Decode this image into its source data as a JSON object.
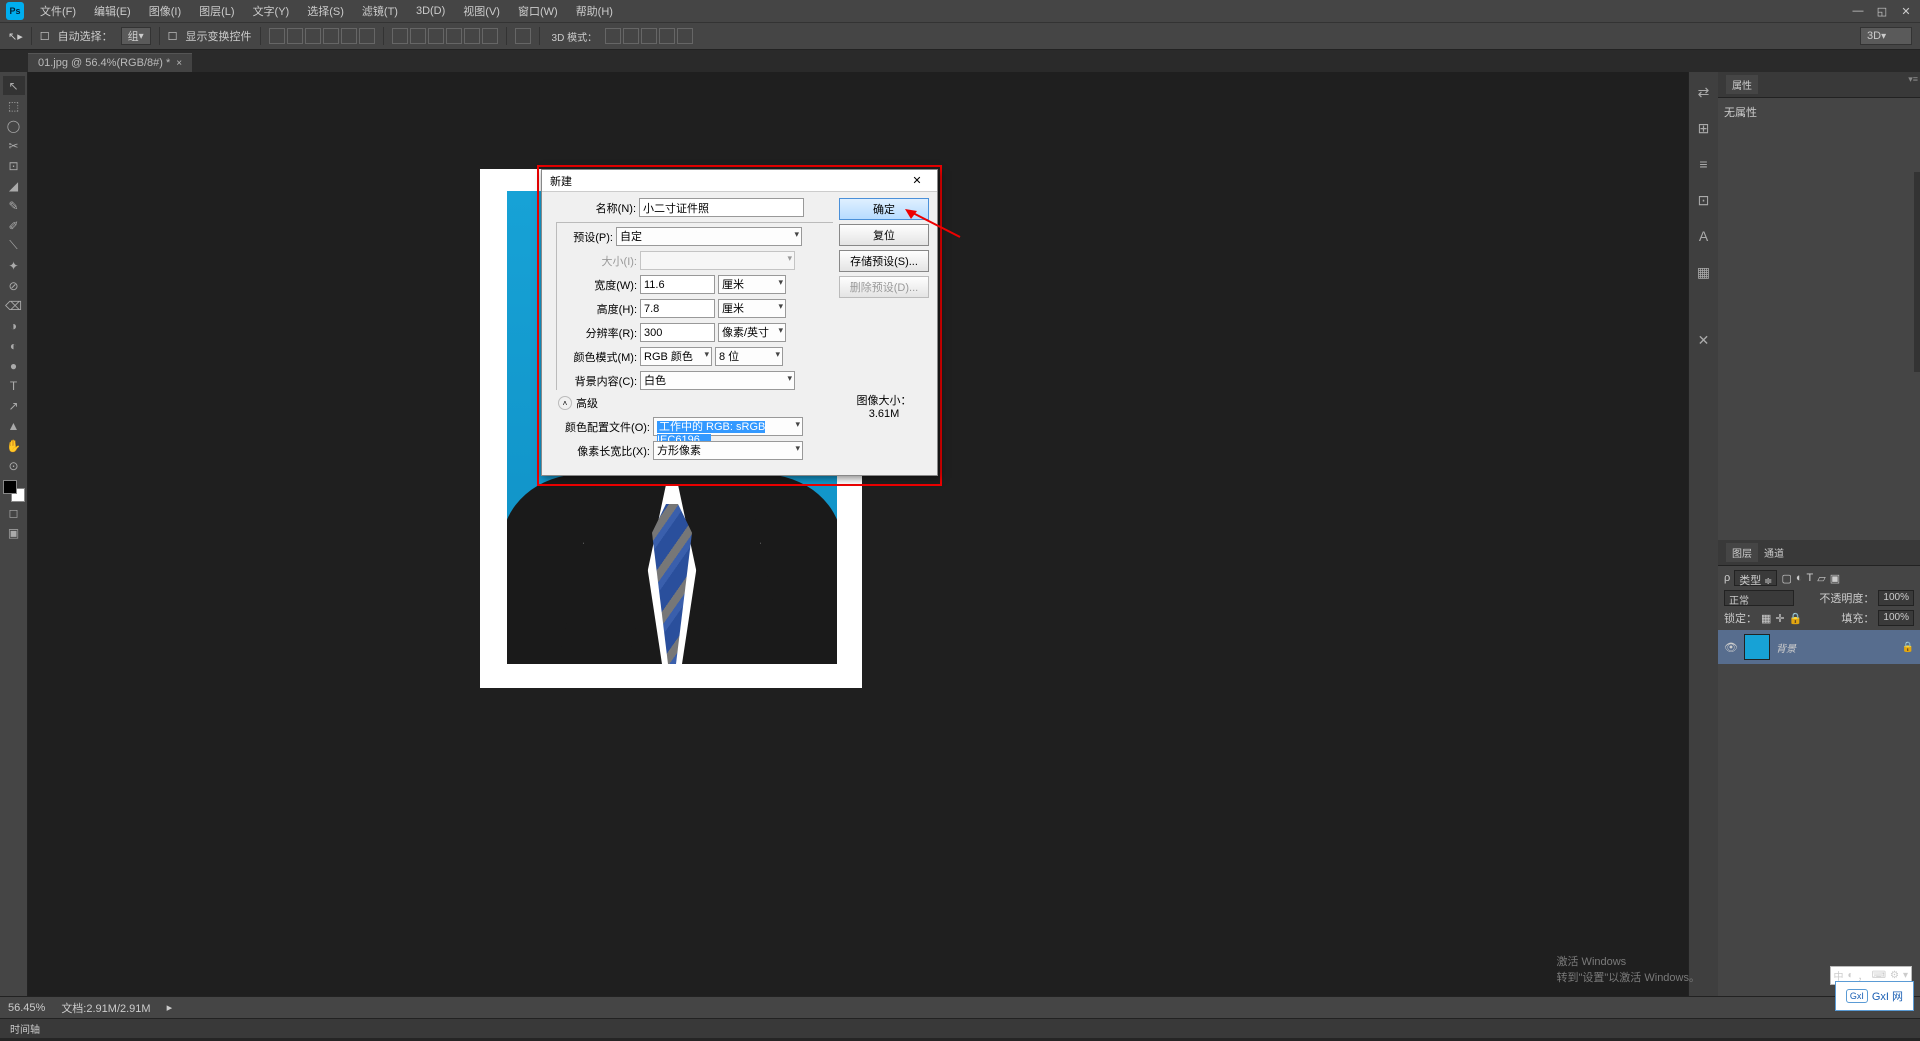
{
  "menubar": {
    "items": [
      "文件(F)",
      "编辑(E)",
      "图像(I)",
      "图层(L)",
      "文字(Y)",
      "选择(S)",
      "滤镜(T)",
      "3D(D)",
      "视图(V)",
      "窗口(W)",
      "帮助(H)"
    ]
  },
  "options_bar": {
    "auto_select_label": "自动选择：",
    "auto_select_target": "组",
    "show_transform_label": "显示变换控件",
    "mode3d_label": "3D 模式：",
    "right_3d": "3D"
  },
  "doc_tab": {
    "title": "01.jpg @ 56.4%(RGB/8#) *"
  },
  "tools": [
    "↖",
    "⬚",
    "◯",
    "✂",
    "⊡",
    "◢",
    "✎",
    "✐",
    "⟍",
    "✦",
    "⊘",
    "⌫",
    "◑",
    "◐",
    "●",
    "▲",
    "✎",
    "T",
    "↗",
    "✥",
    "⊕",
    "✋",
    "⊙"
  ],
  "panel_strip_icons": [
    "⇄",
    "⊞",
    "≡",
    "⊡",
    "A",
    "▦",
    "≡",
    "✕"
  ],
  "properties_panel": {
    "tab": "属性",
    "none_text": "无属性"
  },
  "layers_panel": {
    "tabs": [
      "图层",
      "通道"
    ],
    "type_label": "类型",
    "mode": "正常",
    "opacity_label": "不透明度：",
    "opacity_value": "100%",
    "lock_label": "锁定：",
    "fill_label": "填充：",
    "fill_value": "100%",
    "layer0": {
      "name": "背景"
    }
  },
  "statusbar": {
    "zoom": "56.45%",
    "doc_info": "文档:2.91M/2.91M",
    "timeline_label": "时间轴"
  },
  "dialog": {
    "title": "新建",
    "name_label": "名称(N):",
    "name_value": "小二寸证件照",
    "preset_label": "预设(P):",
    "preset_value": "自定",
    "size_label": "大小(I):",
    "width_label": "宽度(W):",
    "width_value": "11.6",
    "width_unit": "厘米",
    "height_label": "高度(H):",
    "height_value": "7.8",
    "height_unit": "厘米",
    "res_label": "分辨率(R):",
    "res_value": "300",
    "res_unit": "像素/英寸",
    "colormode_label": "颜色模式(M):",
    "colormode_value": "RGB 颜色",
    "colordepth_value": "8 位",
    "bg_label": "背景内容(C):",
    "bg_value": "白色",
    "adv_label": "高级",
    "profile_label": "颜色配置文件(O):",
    "profile_value": "工作中的 RGB: sRGB IEC6196...",
    "aspect_label": "像素长宽比(X):",
    "aspect_value": "方形像素",
    "ok": "确定",
    "cancel": "复位",
    "save_preset": "存储预设(S)...",
    "delete_preset": "删除预设(D)...",
    "img_size_label": "图像大小：",
    "img_size_value": "3.61M"
  },
  "watermark": {
    "activate_title": "激活 Windows",
    "activate_sub": "转到\"设置\"以激活 Windows。",
    "gxl": "GxI 网",
    "tray": "中"
  }
}
